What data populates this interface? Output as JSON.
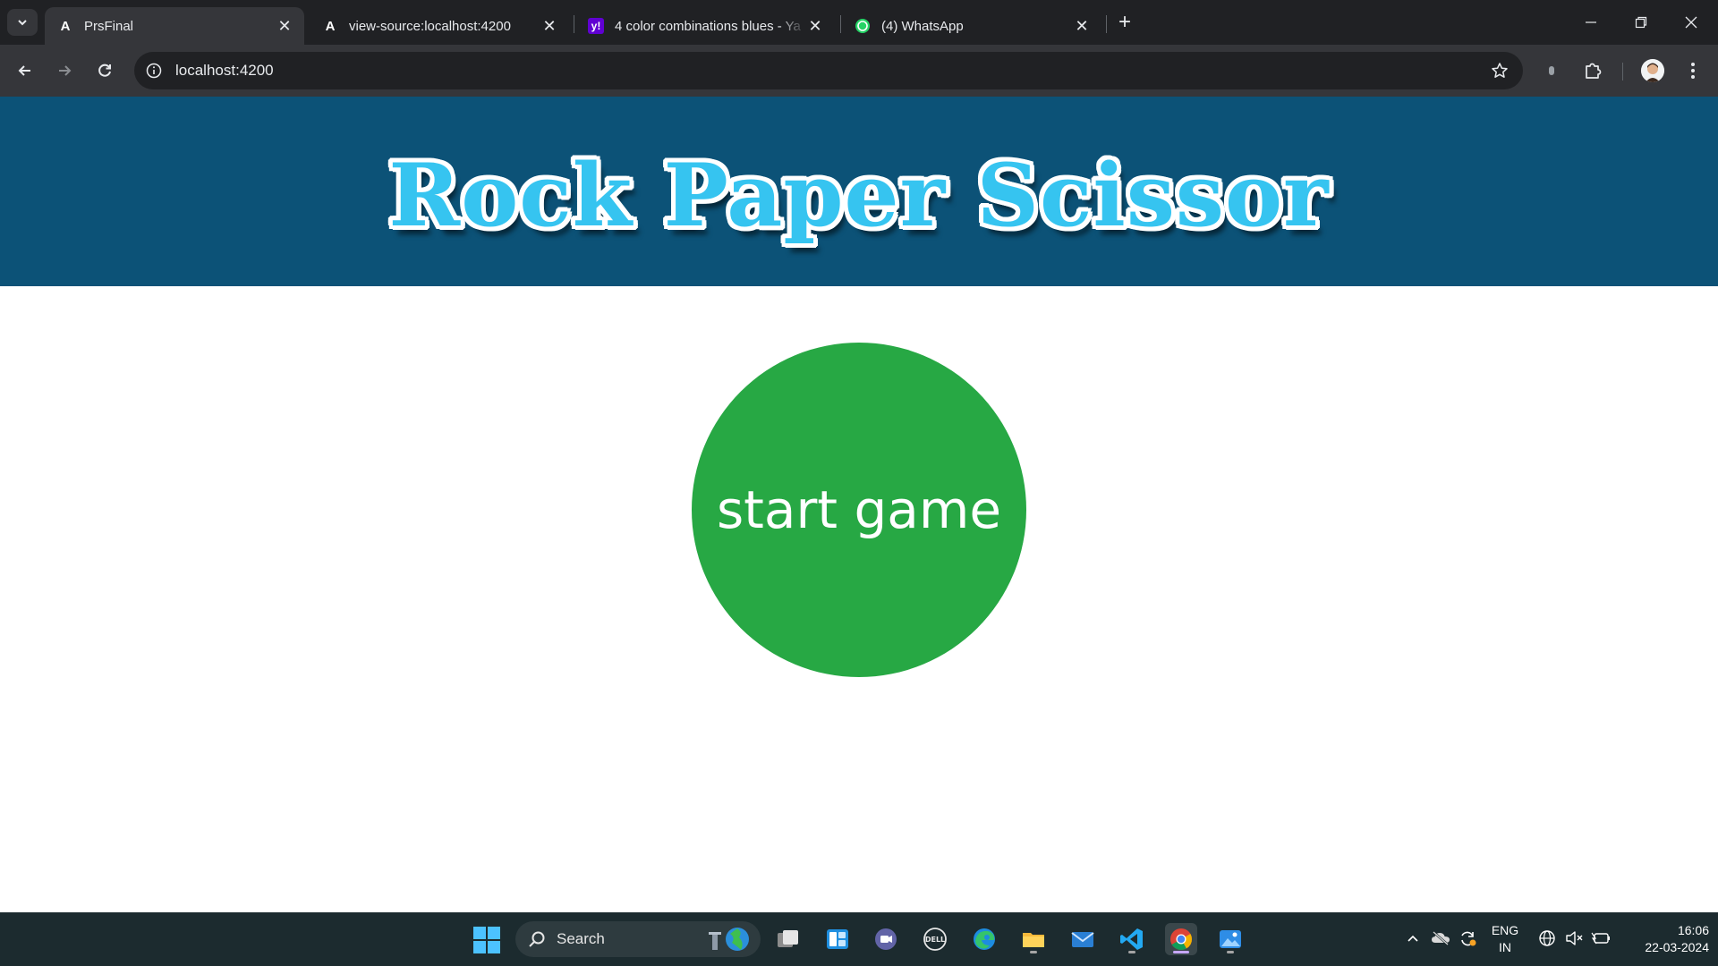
{
  "browser": {
    "tabs": [
      {
        "title": "PrsFinal",
        "favicon": "angular-icon",
        "active": true
      },
      {
        "title": "view-source:localhost:4200",
        "favicon": "angular-icon",
        "active": false
      },
      {
        "title": "4 color combinations blues - Ya",
        "favicon": "yahoo-icon",
        "active": false
      },
      {
        "title": "(4) WhatsApp",
        "favicon": "whatsapp-icon",
        "active": false
      }
    ],
    "close_glyph": "✕",
    "new_tab_glyph": "+",
    "url": "localhost:4200"
  },
  "page": {
    "title": "Rock Paper Scissor",
    "start_button": "start game",
    "colors": {
      "header_bg": "#0c5277",
      "title_fill": "#36c4f0",
      "button_bg": "#27a844"
    }
  },
  "taskbar": {
    "search_label": "Search",
    "apps": [
      "task-view",
      "widgets",
      "teams",
      "dell",
      "edge",
      "file-explorer",
      "mail",
      "vscode",
      "chrome",
      "photos"
    ],
    "language": {
      "line1": "ENG",
      "line2": "IN"
    },
    "clock": {
      "time": "16:06",
      "date": "22-03-2024"
    }
  }
}
